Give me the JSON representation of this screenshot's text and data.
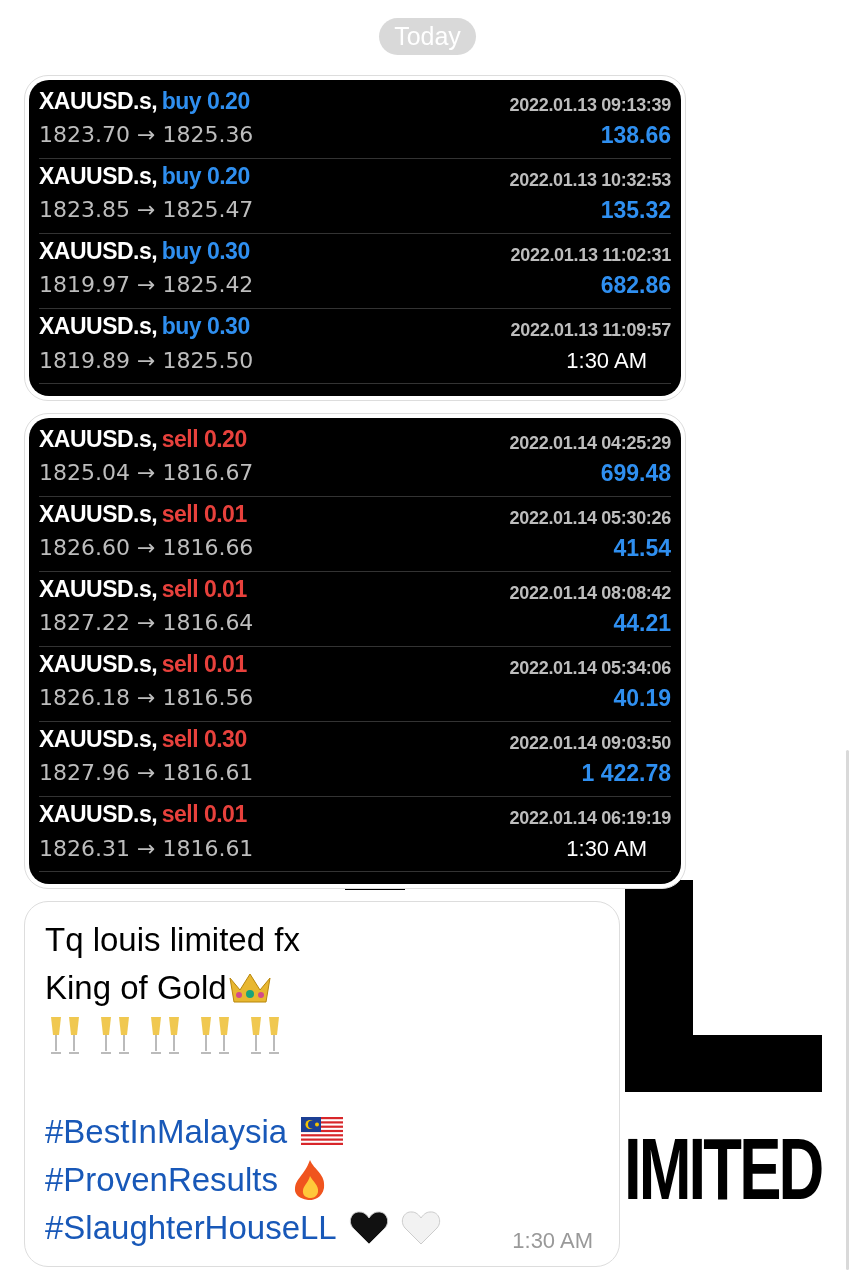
{
  "date_chip": "Today",
  "wallpaper": {
    "logo_text": "IMITED"
  },
  "trade_images": [
    {
      "time": "1:30 AM",
      "trades": [
        {
          "symbol": "XAUUSD.s,",
          "side": "buy 0.20",
          "kind": "buy",
          "datetime": "2022.01.13 09:13:39",
          "prices": "1823.70 → 1825.36",
          "profit": "138.66"
        },
        {
          "symbol": "XAUUSD.s,",
          "side": "buy 0.20",
          "kind": "buy",
          "datetime": "2022.01.13 10:32:53",
          "prices": "1823.85 → 1825.47",
          "profit": "135.32"
        },
        {
          "symbol": "XAUUSD.s,",
          "side": "buy 0.30",
          "kind": "buy",
          "datetime": "2022.01.13 11:02:31",
          "prices": "1819.97 → 1825.42",
          "profit": "682.86"
        },
        {
          "symbol": "XAUUSD.s,",
          "side": "buy 0.30",
          "kind": "buy",
          "datetime": "2022.01.13 11:09:57",
          "prices": "1819.89 → 1825.50"
        }
      ]
    },
    {
      "time": "1:30 AM",
      "trades": [
        {
          "symbol": "XAUUSD.s,",
          "side": "sell 0.20",
          "kind": "sell",
          "datetime": "2022.01.14 04:25:29",
          "prices": "1825.04 → 1816.67",
          "profit": "699.48"
        },
        {
          "symbol": "XAUUSD.s,",
          "side": "sell 0.01",
          "kind": "sell",
          "datetime": "2022.01.14 05:30:26",
          "prices": "1826.60 → 1816.66",
          "profit": "41.54"
        },
        {
          "symbol": "XAUUSD.s,",
          "side": "sell 0.01",
          "kind": "sell",
          "datetime": "2022.01.14 08:08:42",
          "prices": "1827.22 → 1816.64",
          "profit": "44.21"
        },
        {
          "symbol": "XAUUSD.s,",
          "side": "sell 0.01",
          "kind": "sell",
          "datetime": "2022.01.14 05:34:06",
          "prices": "1826.18 → 1816.56",
          "profit": "40.19"
        },
        {
          "symbol": "XAUUSD.s,",
          "side": "sell 0.30",
          "kind": "sell",
          "datetime": "2022.01.14 09:03:50",
          "prices": "1827.96 → 1816.61",
          "profit": "1 422.78"
        },
        {
          "symbol": "XAUUSD.s,",
          "side": "sell 0.01",
          "kind": "sell",
          "datetime": "2022.01.14 06:19:19",
          "prices": "1826.31 → 1816.61"
        }
      ]
    }
  ],
  "text_message": {
    "time": "1:30 AM",
    "lines": [
      {
        "kind": "text",
        "text": "Tq louis limited fx"
      },
      {
        "kind": "crown",
        "text": "King of Gold"
      },
      {
        "kind": "toasts"
      },
      {
        "kind": "blank"
      },
      {
        "kind": "flag",
        "text": "#BestInMalaysia"
      },
      {
        "kind": "fire",
        "text": "#ProvenResults"
      },
      {
        "kind": "hearts",
        "text": "#SlaughterHouseLL"
      }
    ]
  }
}
